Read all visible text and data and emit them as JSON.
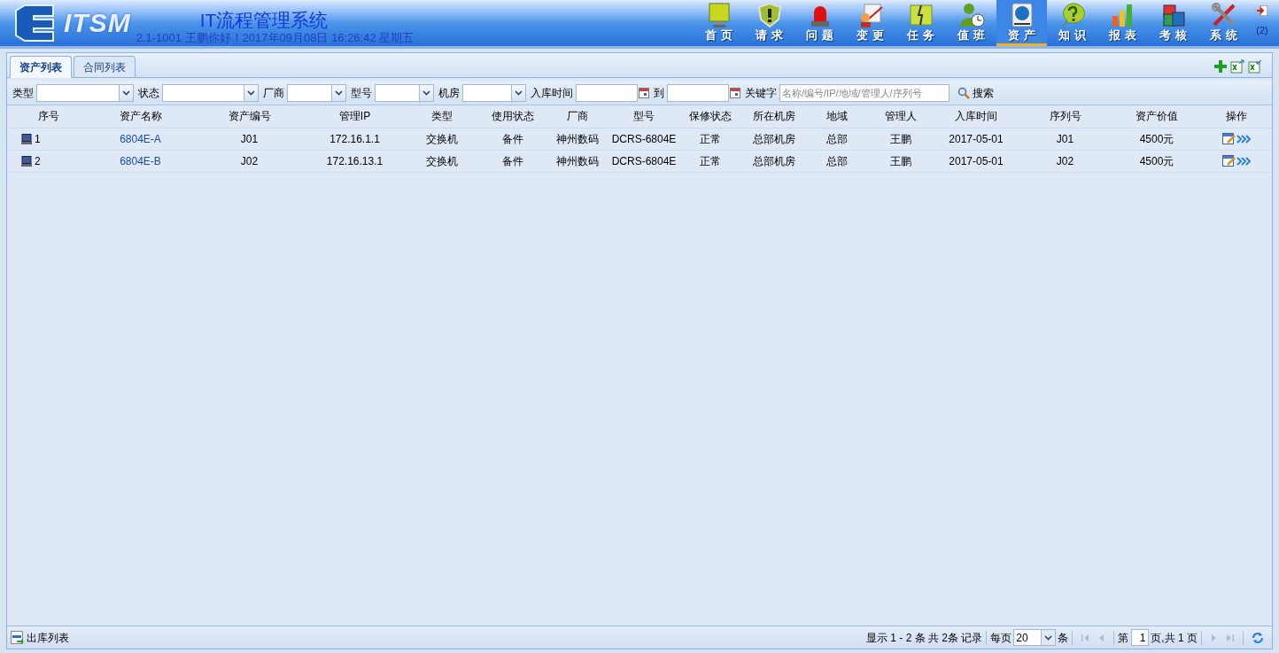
{
  "header": {
    "logo_text": "ITSM",
    "title": "IT流程管理系统",
    "subtitle": "2.1-1001 王鹏你好！2017年09月08日 16:26:42 星期五"
  },
  "nav": [
    {
      "label": "首页",
      "selected": false
    },
    {
      "label": "请求",
      "selected": false
    },
    {
      "label": "问题",
      "selected": false
    },
    {
      "label": "变更",
      "selected": false
    },
    {
      "label": "任务",
      "selected": false
    },
    {
      "label": "值班",
      "selected": false
    },
    {
      "label": "资产",
      "selected": true
    },
    {
      "label": "知识",
      "selected": false
    },
    {
      "label": "报表",
      "selected": false
    },
    {
      "label": "考核",
      "selected": false
    },
    {
      "label": "系统",
      "selected": false
    }
  ],
  "message_count": "(2)",
  "tabs": [
    {
      "label": "资产列表",
      "selected": true
    },
    {
      "label": "合同列表",
      "selected": false
    }
  ],
  "filters": [
    {
      "kind": "select",
      "label": "类型"
    },
    {
      "kind": "select",
      "label": "状态"
    },
    {
      "kind": "select",
      "label": "厂商"
    },
    {
      "kind": "select",
      "label": "型号"
    },
    {
      "kind": "select",
      "label": "机房"
    },
    {
      "kind": "date",
      "label": "入库时间"
    },
    {
      "kind": "date",
      "label": "到"
    },
    {
      "kind": "text",
      "label": "关键字",
      "placeholder": "名称/编号/IP/地域/管理人/序列号"
    }
  ],
  "search_button": "搜索",
  "table": {
    "columns": [
      "序号",
      "资产名称",
      "资产编号",
      "管理IP",
      "类型",
      "使用状态",
      "厂商",
      "型号",
      "保修状态",
      "所在机房",
      "地域",
      "管理人",
      "入库时间",
      "序列号",
      "资产价值",
      "操作"
    ],
    "rows": [
      [
        "1",
        "6804E-A",
        "J01",
        "172.16.1.1",
        "交换机",
        "备件",
        "神州数码",
        "DCRS-6804E",
        "正常",
        "总部机房",
        "总部",
        "王鹏",
        "2017-05-01",
        "J01",
        "4500元"
      ],
      [
        "2",
        "6804E-B",
        "J02",
        "172.16.13.1",
        "交换机",
        "备件",
        "神州数码",
        "DCRS-6804E",
        "正常",
        "总部机房",
        "总部",
        "王鹏",
        "2017-05-01",
        "J02",
        "4500元"
      ]
    ]
  },
  "footer": {
    "outbound_link": "出库列表",
    "summary": "显示 1 - 2 条 共 2条 记录",
    "per_page_label": "每页",
    "per_page": "20",
    "per_page_unit": "条",
    "page_prefix": "第",
    "page": "1",
    "page_suffix": "页,共 1 页"
  }
}
